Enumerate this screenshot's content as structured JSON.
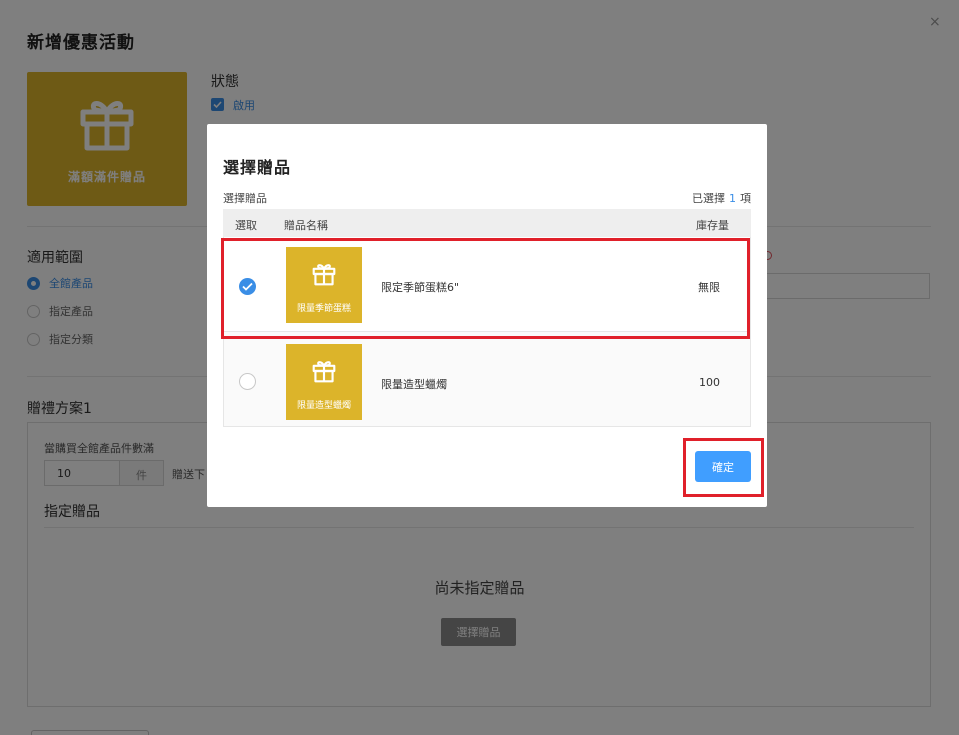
{
  "page": {
    "title": "新增優惠活動",
    "close_icon": "×",
    "promo_card_label": "滿額滿件贈品",
    "status_heading": "狀態",
    "status_option": "啟用",
    "scope_heading": "適用範圍",
    "scope_options": [
      "全館產品",
      "指定產品",
      "指定分類"
    ],
    "plan_heading": "贈禮方案1",
    "condition_label": "當購買全館產品件數滿",
    "quantity_value": "10",
    "quantity_unit": "件",
    "gift_after_label": "贈送下",
    "assigned_heading": "指定贈品",
    "empty_text": "尚未指定贈品",
    "select_gift_button": "選擇贈品"
  },
  "modal": {
    "title": "選擇贈品",
    "subtitle": "選擇贈品",
    "selected_prefix": "已選擇",
    "selected_count": "1",
    "selected_suffix": "項",
    "columns": {
      "select": "選取",
      "name": "贈品名稱",
      "stock": "庫存量"
    },
    "rows": [
      {
        "checked": true,
        "thumb_label": "限量季節蛋糕",
        "name": "限定季節蛋糕6\"",
        "stock": "無限"
      },
      {
        "checked": false,
        "thumb_label": "限量造型蠟燭",
        "name": "限量造型蠟燭",
        "stock": "100"
      }
    ],
    "confirm_button": "確定"
  },
  "colors": {
    "accent": "#409eff",
    "gift_gold": "#dcb42a",
    "highlight_red": "#e0202a"
  }
}
